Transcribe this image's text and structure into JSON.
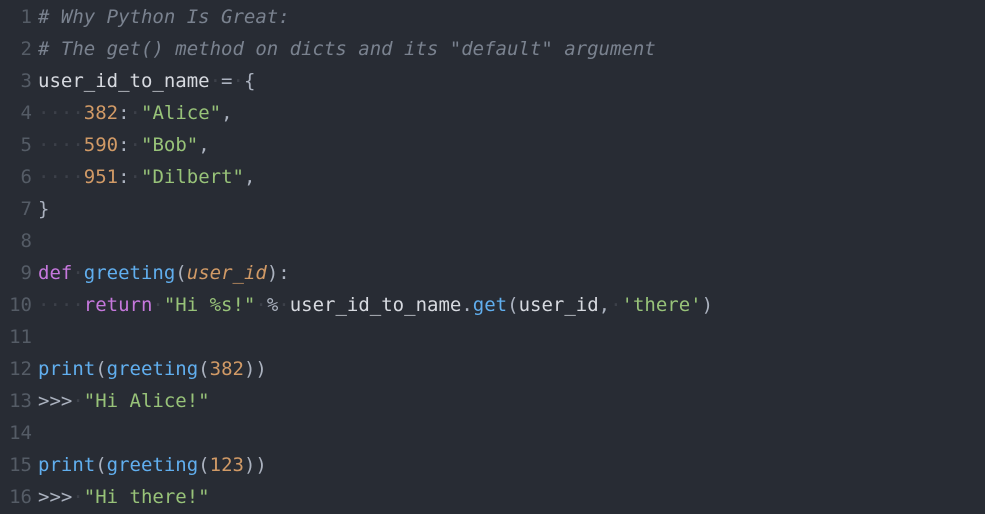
{
  "editor": {
    "language": "python",
    "theme": "one-dark",
    "line_count": 16,
    "lines": [
      {
        "n": 1,
        "tokens": [
          {
            "t": "# Why Python Is Great:",
            "c": "comment"
          }
        ]
      },
      {
        "n": 2,
        "tokens": [
          {
            "t": "# The get() method on dicts and its \"default\" argument",
            "c": "comment"
          }
        ]
      },
      {
        "n": 3,
        "tokens": [
          {
            "t": "user_id_to_name",
            "c": "ident"
          },
          {
            "t": "·",
            "c": "ws"
          },
          {
            "t": "=",
            "c": "op"
          },
          {
            "t": "·",
            "c": "ws"
          },
          {
            "t": "{",
            "c": "brace"
          }
        ]
      },
      {
        "n": 4,
        "tokens": [
          {
            "t": "····",
            "c": "ws"
          },
          {
            "t": "382",
            "c": "num"
          },
          {
            "t": ":",
            "c": "punct"
          },
          {
            "t": "·",
            "c": "ws"
          },
          {
            "t": "\"Alice\"",
            "c": "str"
          },
          {
            "t": ",",
            "c": "punct"
          }
        ]
      },
      {
        "n": 5,
        "tokens": [
          {
            "t": "····",
            "c": "ws"
          },
          {
            "t": "590",
            "c": "num"
          },
          {
            "t": ":",
            "c": "punct"
          },
          {
            "t": "·",
            "c": "ws"
          },
          {
            "t": "\"Bob\"",
            "c": "str"
          },
          {
            "t": ",",
            "c": "punct"
          }
        ]
      },
      {
        "n": 6,
        "tokens": [
          {
            "t": "····",
            "c": "ws"
          },
          {
            "t": "951",
            "c": "num"
          },
          {
            "t": ":",
            "c": "punct"
          },
          {
            "t": "·",
            "c": "ws"
          },
          {
            "t": "\"Dilbert\"",
            "c": "str"
          },
          {
            "t": ",",
            "c": "punct"
          }
        ]
      },
      {
        "n": 7,
        "tokens": [
          {
            "t": "}",
            "c": "brace"
          }
        ]
      },
      {
        "n": 8,
        "tokens": []
      },
      {
        "n": 9,
        "tokens": [
          {
            "t": "def",
            "c": "kw"
          },
          {
            "t": "·",
            "c": "ws"
          },
          {
            "t": "greeting",
            "c": "func"
          },
          {
            "t": "(",
            "c": "punct"
          },
          {
            "t": "user_id",
            "c": "param"
          },
          {
            "t": "):",
            "c": "punct"
          }
        ]
      },
      {
        "n": 10,
        "tokens": [
          {
            "t": "····",
            "c": "ws"
          },
          {
            "t": "return",
            "c": "kw"
          },
          {
            "t": "·",
            "c": "ws"
          },
          {
            "t": "\"Hi %s!\"",
            "c": "str"
          },
          {
            "t": "·",
            "c": "ws"
          },
          {
            "t": "%",
            "c": "op"
          },
          {
            "t": "·",
            "c": "ws"
          },
          {
            "t": "user_id_to_name",
            "c": "ident"
          },
          {
            "t": ".",
            "c": "punct"
          },
          {
            "t": "get",
            "c": "func"
          },
          {
            "t": "(",
            "c": "punct"
          },
          {
            "t": "user_id",
            "c": "ident"
          },
          {
            "t": ",",
            "c": "punct"
          },
          {
            "t": "·",
            "c": "ws"
          },
          {
            "t": "'there'",
            "c": "str"
          },
          {
            "t": ")",
            "c": "punct"
          }
        ]
      },
      {
        "n": 11,
        "tokens": []
      },
      {
        "n": 12,
        "tokens": [
          {
            "t": "print",
            "c": "func"
          },
          {
            "t": "(",
            "c": "punct"
          },
          {
            "t": "greeting",
            "c": "func"
          },
          {
            "t": "(",
            "c": "punct"
          },
          {
            "t": "382",
            "c": "num"
          },
          {
            "t": "))",
            "c": "punct"
          }
        ]
      },
      {
        "n": 13,
        "tokens": [
          {
            "t": ">>>",
            "c": "op"
          },
          {
            "t": "·",
            "c": "ws"
          },
          {
            "t": "\"Hi Alice!\"",
            "c": "str"
          }
        ]
      },
      {
        "n": 14,
        "tokens": []
      },
      {
        "n": 15,
        "tokens": [
          {
            "t": "print",
            "c": "func"
          },
          {
            "t": "(",
            "c": "punct"
          },
          {
            "t": "greeting",
            "c": "func"
          },
          {
            "t": "(",
            "c": "punct"
          },
          {
            "t": "123",
            "c": "num"
          },
          {
            "t": "))",
            "c": "punct"
          }
        ]
      },
      {
        "n": 16,
        "tokens": [
          {
            "t": ">>>",
            "c": "op"
          },
          {
            "t": "·",
            "c": "ws"
          },
          {
            "t": "\"Hi there!\"",
            "c": "str"
          }
        ]
      }
    ]
  }
}
